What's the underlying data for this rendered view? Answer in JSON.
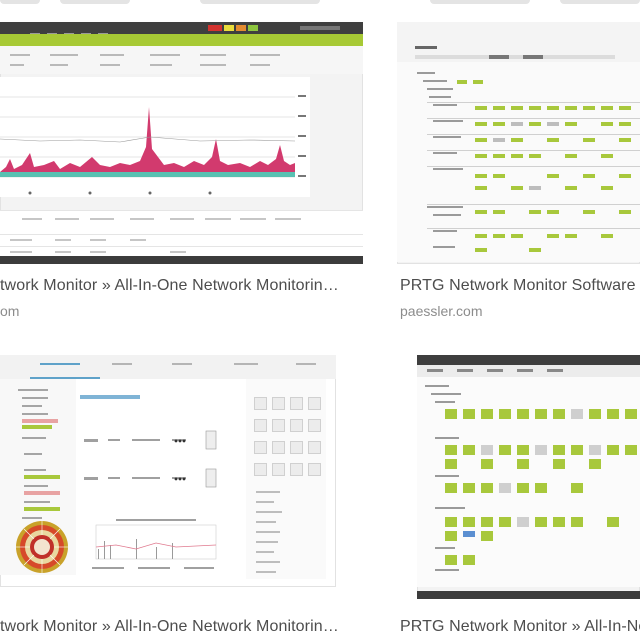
{
  "results": [
    {
      "caption": "twork Monitor » All-In-One Network Monitorin…",
      "source": "om",
      "thumbnail": "prtg-sensor-graph-screenshot"
    },
    {
      "caption": "PRTG Network Monitor Software",
      "source": "paessler.com",
      "thumbnail": "prtg-device-tree-screenshot"
    },
    {
      "caption": "twork Monitor » All-In-One Network Monitorin…",
      "source": "",
      "thumbnail": "prtg-sunburst-map-screenshot"
    },
    {
      "caption": "PRTG Network Monitor » All-In-Network",
      "source": "",
      "thumbnail": "prtg-device-grid-screenshot"
    }
  ],
  "colors": {
    "prtg_green": "#a7c935",
    "chart_pink": "#d23a6e",
    "chart_teal": "#3cb6a5",
    "caption_text": "#4d4d4d",
    "source_text": "#8c8c8c"
  }
}
